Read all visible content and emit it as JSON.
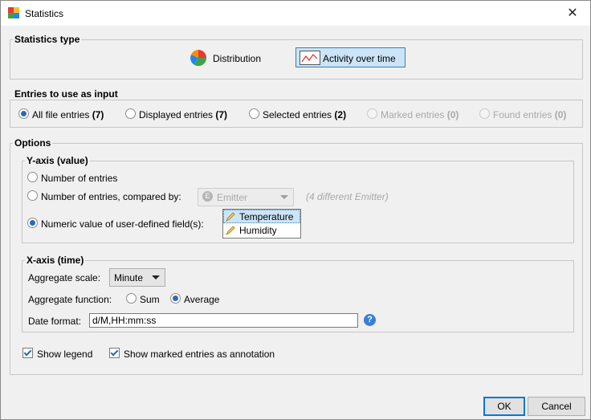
{
  "window": {
    "title": "Statistics"
  },
  "stats_type": {
    "legend": "Statistics type",
    "distribution": "Distribution",
    "activity": "Activity over time"
  },
  "entries": {
    "legend": "Entries to use as input",
    "all": {
      "label": "All file entries",
      "count": "(7)"
    },
    "displayed": {
      "label": "Displayed entries",
      "count": "(7)"
    },
    "selected": {
      "label": "Selected entries",
      "count": "(2)"
    },
    "marked": {
      "label": "Marked entries",
      "count": "(0)"
    },
    "found": {
      "label": "Found entries",
      "count": "(0)"
    }
  },
  "options": {
    "legend": "Options",
    "yaxis": {
      "legend": "Y-axis (value)",
      "num_entries": "Number of entries",
      "compared_by": "Number of entries, compared by:",
      "compared_value": "Emitter",
      "compared_hint": "(4 different Emitter)",
      "numeric_value": "Numeric value of user-defined field(s):",
      "fields": [
        "Temperature",
        "Humidity"
      ]
    },
    "xaxis": {
      "legend": "X-axis (time)",
      "agg_scale_label": "Aggregate scale:",
      "agg_scale_value": "Minute",
      "agg_func_label": "Aggregate function:",
      "sum": "Sum",
      "average": "Average",
      "date_format_label": "Date format:",
      "date_format_value": "d/M,HH:mm:ss"
    },
    "show_legend": "Show legend",
    "show_marked": "Show marked entries as annotation"
  },
  "buttons": {
    "ok": "OK",
    "cancel": "Cancel"
  },
  "colors": {
    "accent": "#2a6ab3",
    "selection": "#cce4f7",
    "help": "#3a7fd5"
  }
}
